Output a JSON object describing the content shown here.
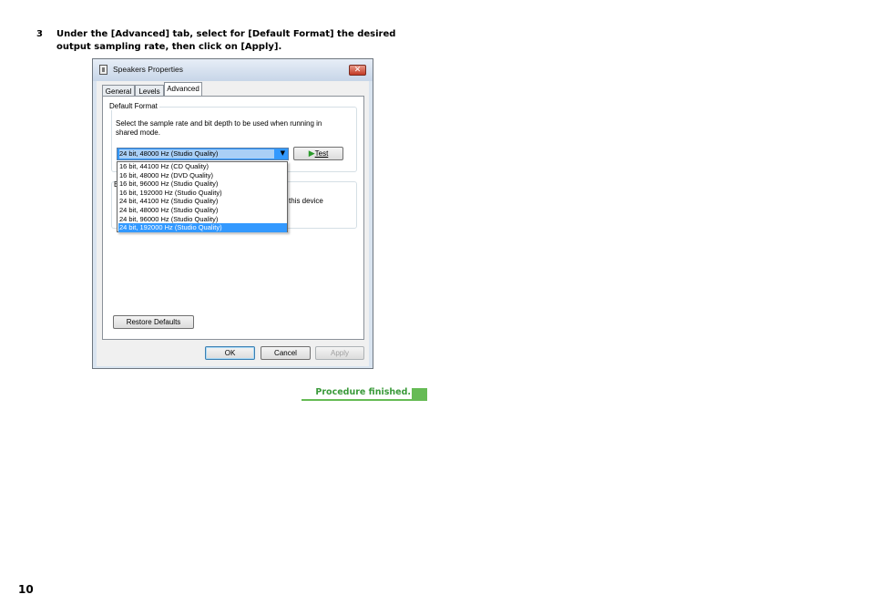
{
  "instruction": {
    "step_number": "3",
    "text": "Under the [Advanced] tab, select for [Default Format] the desired output sampling rate, then click on [Apply]."
  },
  "dialog": {
    "title": "Speakers Properties",
    "close_glyph": "✕",
    "tabs": [
      "General",
      "Levels",
      "Advanced"
    ],
    "default_format": {
      "group_label": "Default Format",
      "description": "Select the sample rate and bit depth to be used when running in shared mode.",
      "selected_value": "24 bit, 48000 Hz (Studio Quality)",
      "test_label": "Test",
      "options": [
        "16 bit, 44100 Hz (CD Quality)",
        "16 bit, 48000 Hz (DVD Quality)",
        "16 bit, 96000 Hz (Studio Quality)",
        "16 bit, 192000 Hz (Studio Quality)",
        "24 bit, 44100 Hz (Studio Quality)",
        "24 bit, 48000 Hz (Studio Quality)",
        "24 bit, 96000 Hz (Studio Quality)",
        "24 bit, 192000 Hz (Studio Quality)"
      ],
      "highlighted_index": 7
    },
    "exclusive_partial_text": "this device",
    "exclusive_partial_prefix": "E",
    "restore_defaults_label": "Restore Defaults",
    "ok_label": "OK",
    "cancel_label": "Cancel",
    "apply_label": "Apply"
  },
  "procedure_finished": "Procedure finished.",
  "page_number": "10"
}
